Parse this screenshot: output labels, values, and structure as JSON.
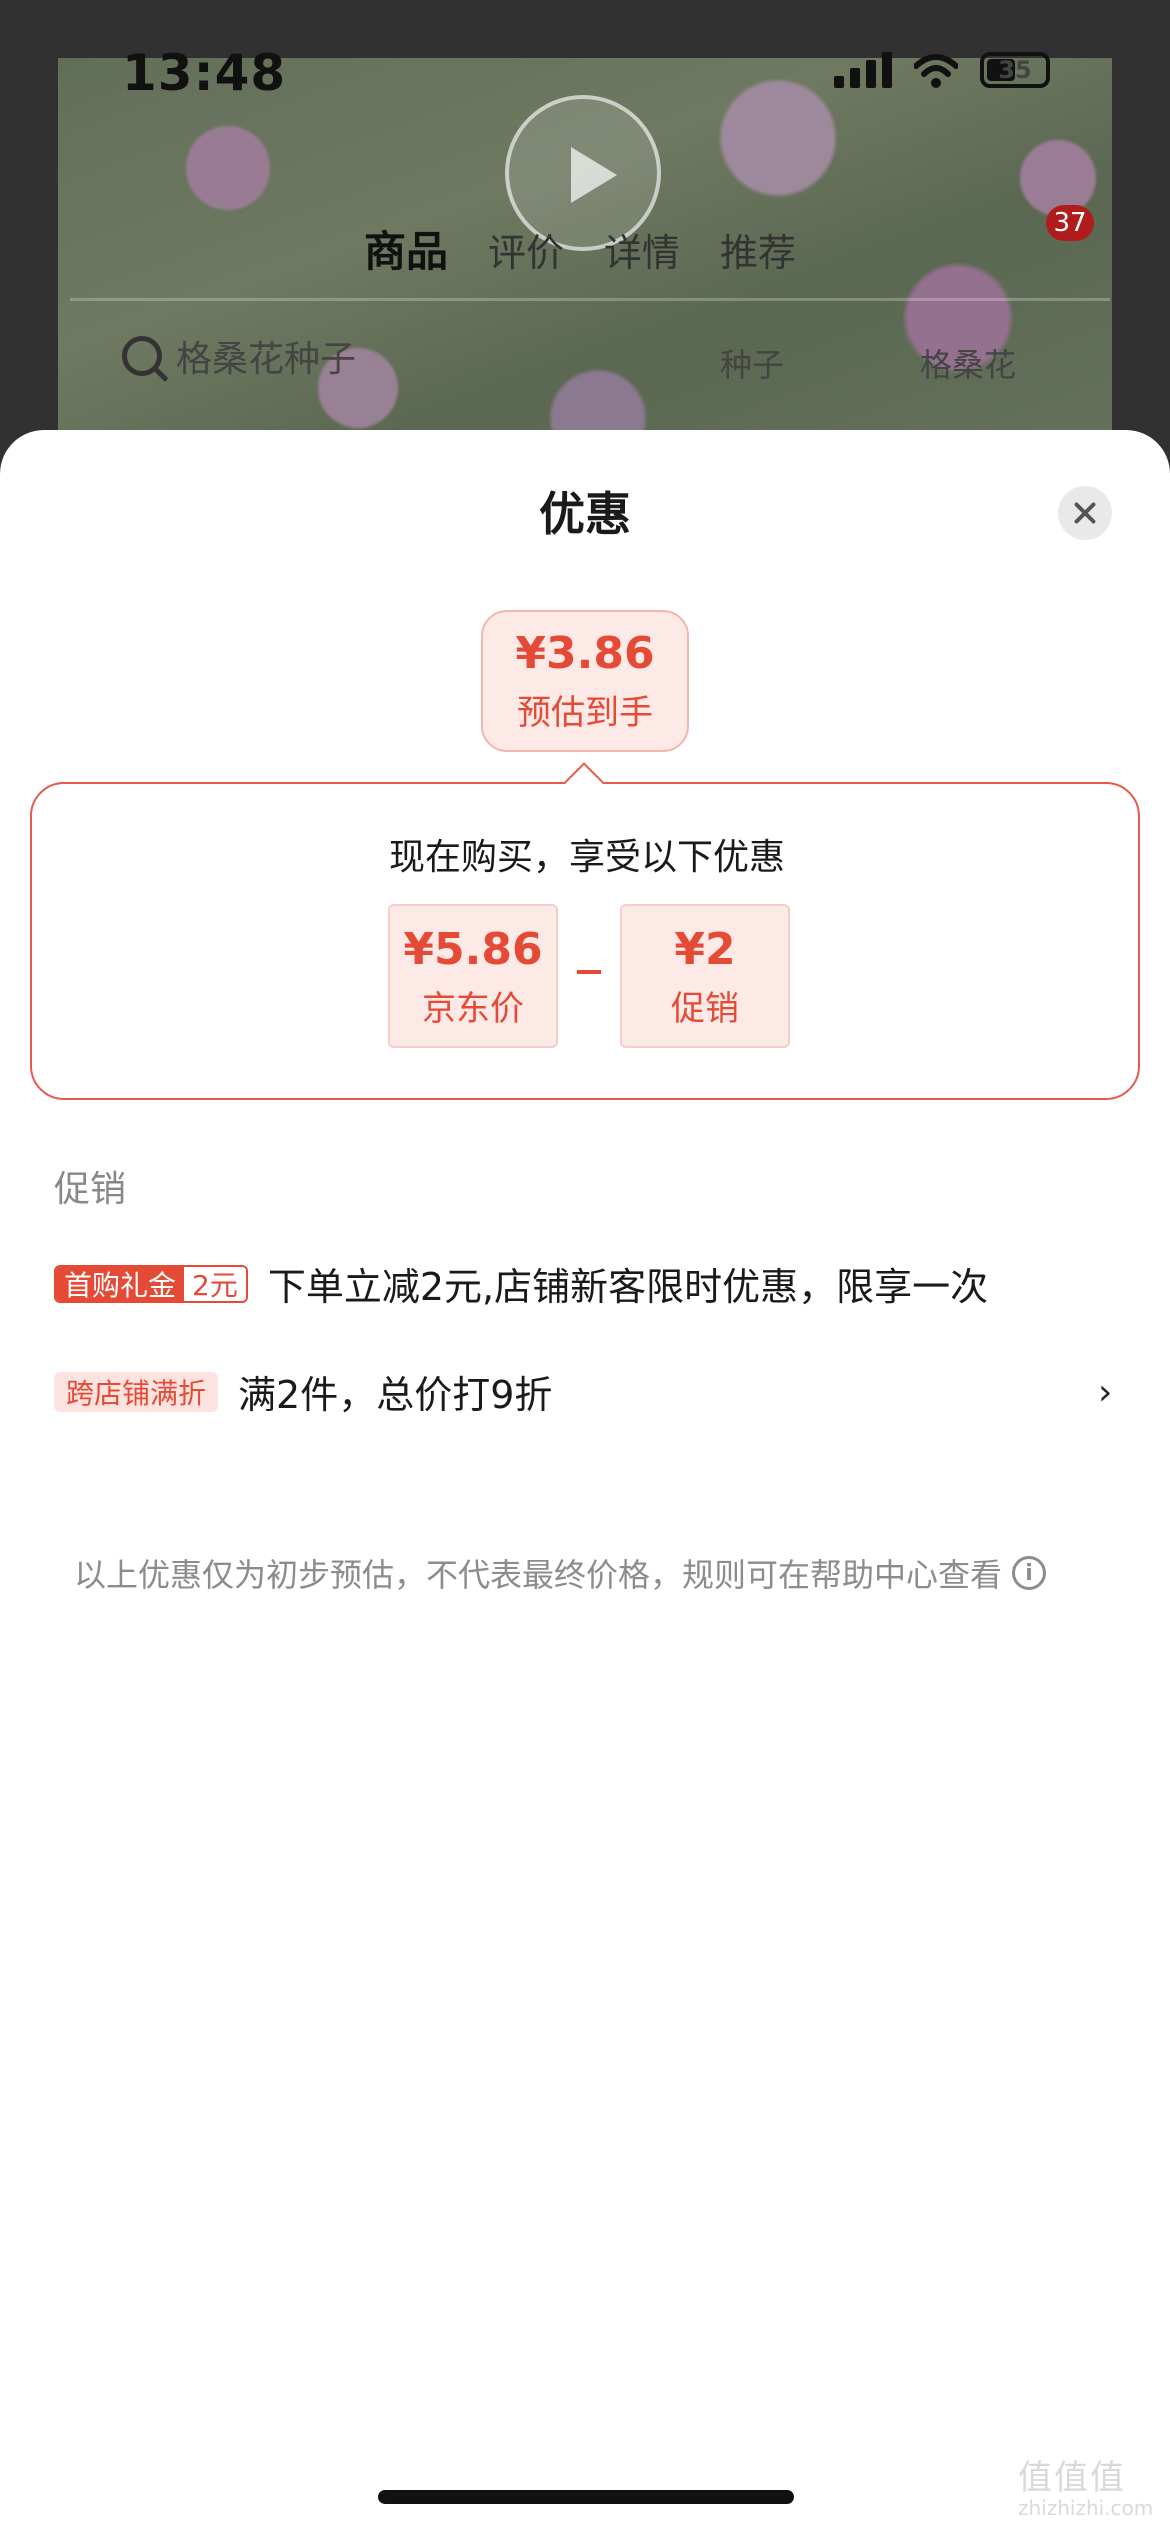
{
  "status_bar": {
    "time": "13:48",
    "battery": "35"
  },
  "background": {
    "tabs": [
      "商品",
      "评价",
      "详情",
      "推荐"
    ],
    "badge": "37",
    "search_text": "格桑花种子",
    "chip1": "种子",
    "chip2": "格桑花"
  },
  "sheet": {
    "title": "优惠",
    "estimate": {
      "price": "¥3.86",
      "label": "预估到手"
    },
    "offer": {
      "heading": "现在购买，享受以下优惠",
      "jd_price": {
        "price": "¥5.86",
        "label": "京东价"
      },
      "promotion": {
        "price": "¥2",
        "label": "促销"
      }
    },
    "section_title": "促销",
    "promos": [
      {
        "tag_left": "首购礼金",
        "tag_right": "2元",
        "text": "下单立减2元,店铺新客限时优惠，限享一次"
      },
      {
        "tag": "跨店铺满折",
        "text": "满2件，总价打9折"
      }
    ],
    "disclaimer": "以上优惠仅为初步预估，不代表最终价格，规则可在帮助中心查看",
    "info_icon": "i"
  },
  "watermark": {
    "main": "值值值",
    "sub": "zhizhizhi.com"
  },
  "colors": {
    "accent": "#e44a35",
    "tag_bg": "#fde3e0"
  }
}
